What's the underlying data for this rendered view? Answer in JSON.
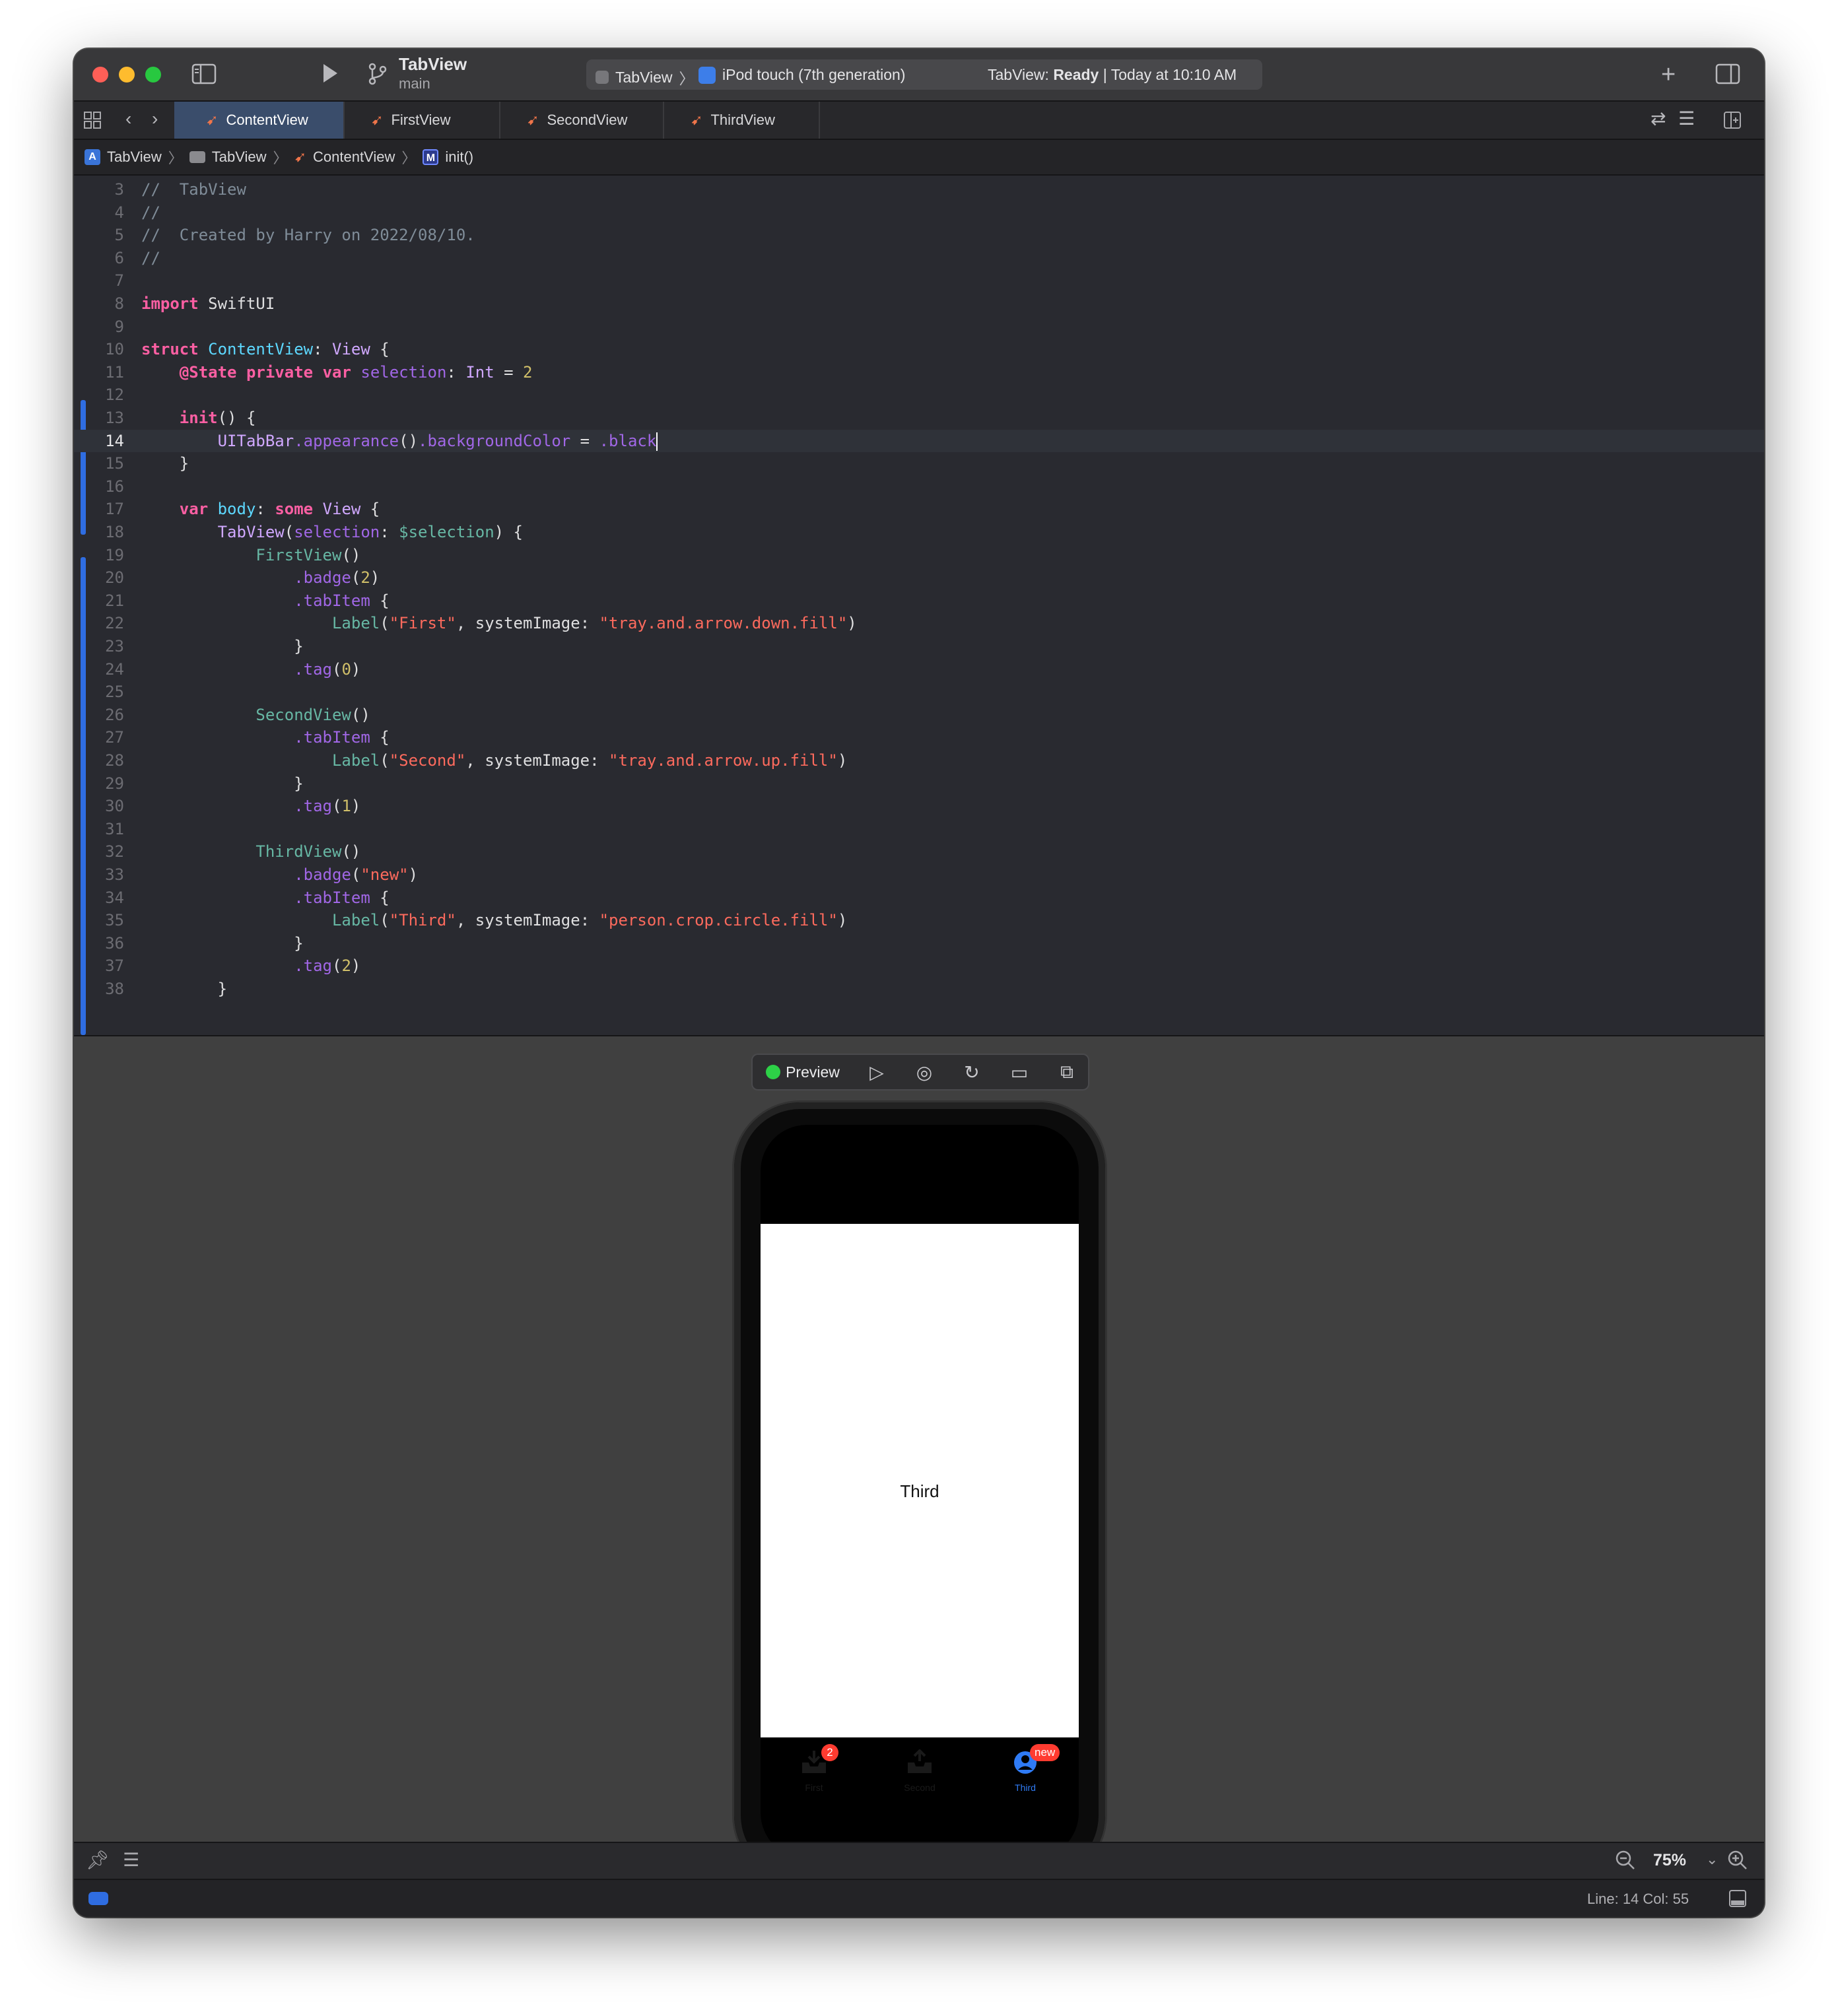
{
  "titlebar": {
    "project_name": "TabView",
    "branch": "main",
    "scheme": "TabView",
    "destination": "iPod touch (7th generation)",
    "status_prefix": "TabView:",
    "status_state": "Ready",
    "status_time": "| Today at 10:10 AM"
  },
  "tabs": [
    {
      "label": "ContentView",
      "active": true
    },
    {
      "label": "FirstView",
      "active": false
    },
    {
      "label": "SecondView",
      "active": false
    },
    {
      "label": "ThirdView",
      "active": false
    }
  ],
  "breadcrumb": [
    "TabView",
    "TabView",
    "ContentView",
    "init()"
  ],
  "editor": {
    "current_line": 14,
    "lines": [
      {
        "n": "3",
        "code": "//  TabView"
      },
      {
        "n": "4",
        "code": "//"
      },
      {
        "n": "5",
        "code": "//  Created by Harry on 2022/08/10."
      },
      {
        "n": "6",
        "code": "//"
      },
      {
        "n": "7",
        "code": ""
      },
      {
        "n": "8",
        "code": "import SwiftUI"
      },
      {
        "n": "9",
        "code": ""
      },
      {
        "n": "10",
        "code": "struct ContentView: View {"
      },
      {
        "n": "11",
        "code": "    @State private var selection: Int = 2"
      },
      {
        "n": "12",
        "code": ""
      },
      {
        "n": "13",
        "code": "    init() {"
      },
      {
        "n": "14",
        "code": "        UITabBar.appearance().backgroundColor = .black"
      },
      {
        "n": "15",
        "code": "    }"
      },
      {
        "n": "16",
        "code": ""
      },
      {
        "n": "17",
        "code": "    var body: some View {"
      },
      {
        "n": "18",
        "code": "        TabView(selection: $selection) {"
      },
      {
        "n": "19",
        "code": "            FirstView()"
      },
      {
        "n": "20",
        "code": "                .badge(2)"
      },
      {
        "n": "21",
        "code": "                .tabItem {"
      },
      {
        "n": "22",
        "code": "                    Label(\"First\", systemImage: \"tray.and.arrow.down.fill\")"
      },
      {
        "n": "23",
        "code": "                }"
      },
      {
        "n": "24",
        "code": "                .tag(0)"
      },
      {
        "n": "25",
        "code": ""
      },
      {
        "n": "26",
        "code": "            SecondView()"
      },
      {
        "n": "27",
        "code": "                .tabItem {"
      },
      {
        "n": "28",
        "code": "                    Label(\"Second\", systemImage: \"tray.and.arrow.up.fill\")"
      },
      {
        "n": "29",
        "code": "                }"
      },
      {
        "n": "30",
        "code": "                .tag(1)"
      },
      {
        "n": "31",
        "code": ""
      },
      {
        "n": "32",
        "code": "            ThirdView()"
      },
      {
        "n": "33",
        "code": "                .badge(\"new\")"
      },
      {
        "n": "34",
        "code": "                .tabItem {"
      },
      {
        "n": "35",
        "code": "                    Label(\"Third\", systemImage: \"person.crop.circle.fill\")"
      },
      {
        "n": "36",
        "code": "                }"
      },
      {
        "n": "37",
        "code": "                .tag(2)"
      },
      {
        "n": "38",
        "code": "        }"
      }
    ]
  },
  "preview": {
    "toolbar_label": "Preview",
    "status_color": "#2dd147",
    "screen_text": "Third",
    "tab_items": [
      {
        "label": "First",
        "icon": "tray-arrow-down-icon",
        "badge": "2",
        "selected": false
      },
      {
        "label": "Second",
        "icon": "tray-arrow-up-icon",
        "badge": "",
        "selected": false
      },
      {
        "label": "Third",
        "icon": "person-circle-icon",
        "badge": "new",
        "selected": true
      }
    ],
    "accent": "#2f7bf5"
  },
  "canvas": {
    "zoom": "75%"
  },
  "statusbar": {
    "line_col": "Line: 14  Col: 55"
  }
}
